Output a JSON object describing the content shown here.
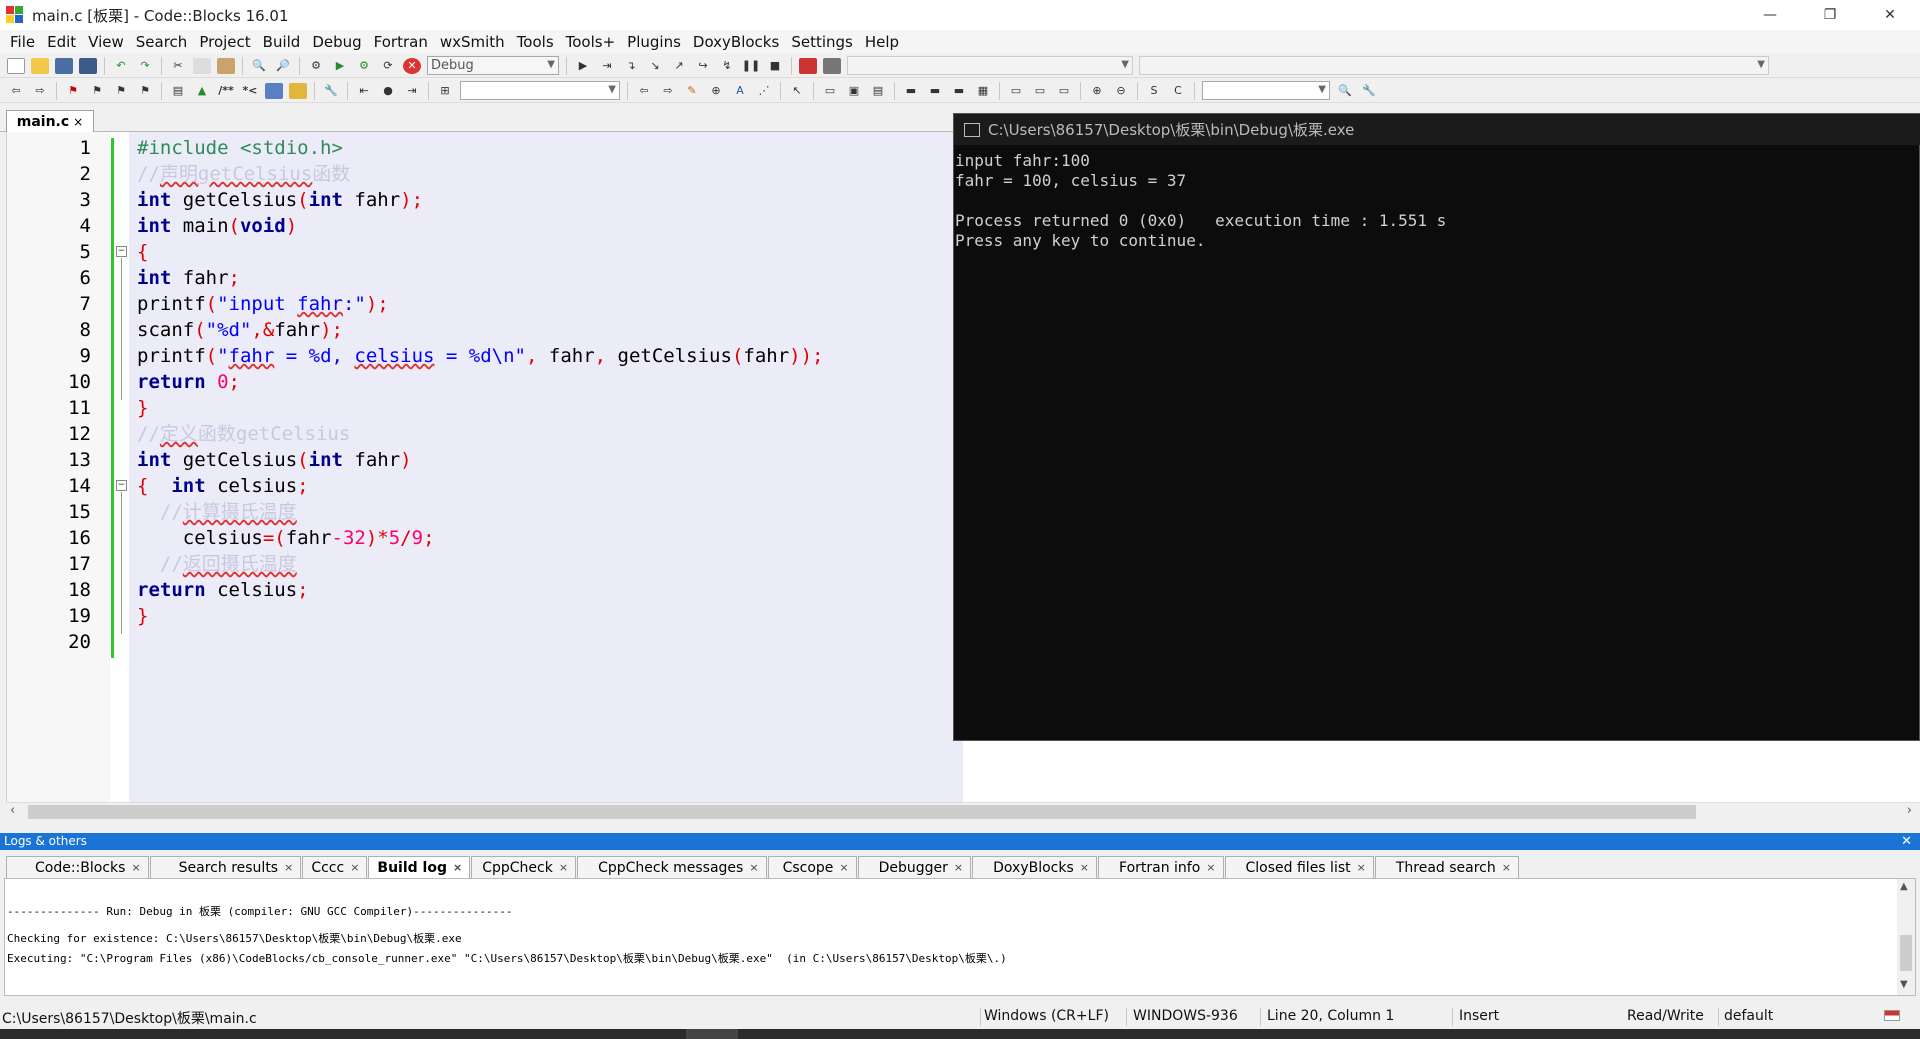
{
  "window": {
    "title": "main.c [板栗] - Code::Blocks 16.01",
    "minimize_icon": "—",
    "restore_icon": "❐",
    "close_icon": "✕"
  },
  "menu": [
    "File",
    "Edit",
    "View",
    "Search",
    "Project",
    "Build",
    "Debug",
    "Fortran",
    "wxSmith",
    "Tools",
    "Tools+",
    "Plugins",
    "DoxyBlocks",
    "Settings",
    "Help"
  ],
  "toolbar": {
    "build_target": "Debug",
    "symbol_combo": "",
    "search_combo": "",
    "doxy_label": "/**",
    "doxy2_label": "*<"
  },
  "editor": {
    "tab_label": "main.c",
    "tab_close": "×",
    "lines": [
      {
        "n": "1"
      },
      {
        "n": "2"
      },
      {
        "n": "3"
      },
      {
        "n": "4"
      },
      {
        "n": "5"
      },
      {
        "n": "6"
      },
      {
        "n": "7"
      },
      {
        "n": "8"
      },
      {
        "n": "9"
      },
      {
        "n": "10"
      },
      {
        "n": "11"
      },
      {
        "n": "12"
      },
      {
        "n": "13"
      },
      {
        "n": "14"
      },
      {
        "n": "15"
      },
      {
        "n": "16"
      },
      {
        "n": "17"
      },
      {
        "n": "18"
      },
      {
        "n": "19"
      },
      {
        "n": "20"
      }
    ],
    "code": {
      "l1_pp": "#include <stdio.h>",
      "l2_comment_a": "//",
      "l2_comment_b": "声明",
      "l2_comment_c": "getCelsius",
      "l2_comment_d": "函数",
      "l3_kw": "int",
      "l3_a": " getCelsius",
      "l3_p1": "(",
      "l3_kw2": "int",
      "l3_b": " fahr",
      "l3_p2": ");",
      "l4_kw": "int",
      "l4_a": " main",
      "l4_p1": "(",
      "l4_kw2": "void",
      "l4_p2": ")",
      "l5": "{",
      "l6_kw": "int",
      "l6_a": " fahr",
      "l6_p": ";",
      "l7_a": "printf",
      "l7_p1": "(",
      "l7_s1": "\"input ",
      "l7_s2": "fahr",
      "l7_s3": ":\"",
      "l7_p2": ");",
      "l8_a": "scanf",
      "l8_p1": "(",
      "l8_s": "\"%d\"",
      "l8_p2": ",&",
      "l8_b": "fahr",
      "l8_p3": ");",
      "l9_a": "printf",
      "l9_p1": "(",
      "l9_s1": "\"",
      "l9_s2": "fahr",
      "l9_s3": " = %d, ",
      "l9_s4": "celsius",
      "l9_s5": " = %d\\n\"",
      "l9_p2": ",",
      "l9_b": " fahr",
      "l9_p3": ",",
      "l9_c": " getCelsius",
      "l9_p4": "(",
      "l9_d": "fahr",
      "l9_p5": "));",
      "l10_kw": "return",
      "l10_n": " 0",
      "l10_p": ";",
      "l11": "}",
      "l12_comment_a": "//",
      "l12_comment_b": "定义",
      "l12_comment_c": "函数getCelsius",
      "l13_kw": "int",
      "l13_a": " getCelsius",
      "l13_p1": "(",
      "l13_kw2": "int",
      "l13_b": " fahr",
      "l13_p2": ")",
      "l14_p": "{",
      "l14_kw": "  int",
      "l14_a": " celsius",
      "l14_p2": ";",
      "l15_comment_a": "  //",
      "l15_comment_b": "计算摄氏温度",
      "l16_a": "    celsius",
      "l16_p1": "=(",
      "l16_b": "fahr",
      "l16_n1": "-32",
      "l16_p2": ")*",
      "l16_n2": "5",
      "l16_p3": "/",
      "l16_n3": "9",
      "l16_p4": ";",
      "l17_comment_a": "  //",
      "l17_comment_b": "返回摄氏温度",
      "l18_kw": "return",
      "l18_a": " celsius",
      "l18_p": ";",
      "l19": "}"
    }
  },
  "console": {
    "title": "C:\\Users\\86157\\Desktop\\板栗\\bin\\Debug\\板栗.exe",
    "output": "input fahr:100\nfahr = 100, celsius = 37\n\nProcess returned 0 (0x0)   execution time : 1.551 s\nPress any key to continue."
  },
  "logs": {
    "header": "Logs & others",
    "close": "✕",
    "tabs": [
      {
        "label": "Code::Blocks",
        "active": false
      },
      {
        "label": "Search results",
        "active": false
      },
      {
        "label": "Cccc",
        "active": false
      },
      {
        "label": "Build log",
        "active": true
      },
      {
        "label": "CppCheck",
        "active": false
      },
      {
        "label": "CppCheck messages",
        "active": false
      },
      {
        "label": "Cscope",
        "active": false
      },
      {
        "label": "Debugger",
        "active": false
      },
      {
        "label": "DoxyBlocks",
        "active": false
      },
      {
        "label": "Fortran info",
        "active": false
      },
      {
        "label": "Closed files list",
        "active": false
      },
      {
        "label": "Thread search",
        "active": false
      }
    ],
    "tab_close": "×",
    "lines": [
      "-------------- Run: Debug in 板栗 (compiler: GNU GCC Compiler)---------------",
      "Checking for existence: C:\\Users\\86157\\Desktop\\板栗\\bin\\Debug\\板栗.exe",
      "Executing: \"C:\\Program Files (x86)\\CodeBlocks/cb_console_runner.exe\" \"C:\\Users\\86157\\Desktop\\板栗\\bin\\Debug\\板栗.exe\"  (in C:\\Users\\86157\\Desktop\\板栗\\.)"
    ]
  },
  "status": {
    "path": "C:\\Users\\86157\\Desktop\\板栗\\main.c",
    "eol": "Windows (CR+LF)",
    "encoding": "WINDOWS-936",
    "position": "Line 20, Column 1",
    "mode": "Insert",
    "access": "Read/Write",
    "profile": "default"
  }
}
